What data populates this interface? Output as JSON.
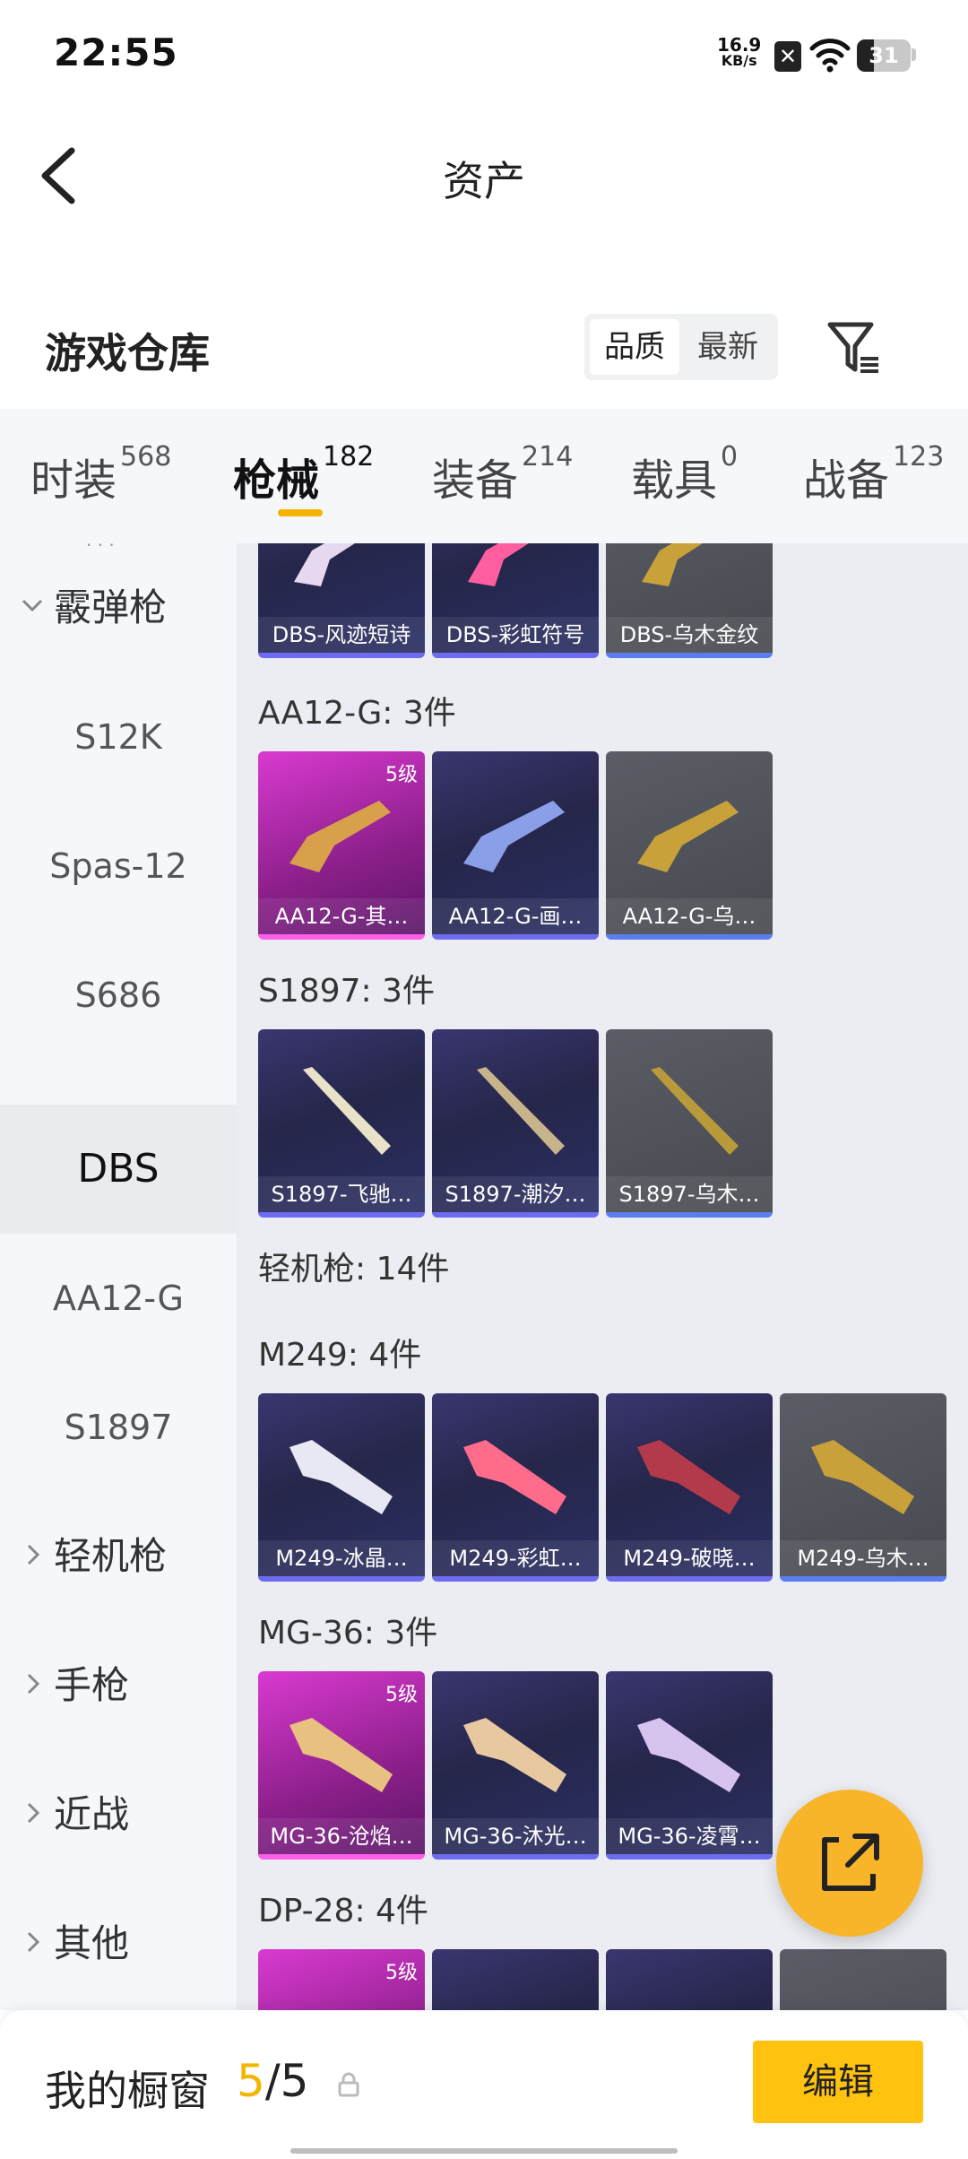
{
  "status_bar": {
    "time": "22:55",
    "net_speed_value": "16.9",
    "net_speed_unit": "KB/s",
    "battery_level": "31",
    "battery_fraction": 0.31
  },
  "header": {
    "title": "资产"
  },
  "section": {
    "title": "游戏仓库",
    "sort_options": [
      "品质",
      "最新"
    ],
    "sort_selected": "品质"
  },
  "tabs": [
    {
      "label": "时装",
      "count": "568"
    },
    {
      "label": "枪械",
      "count": "182"
    },
    {
      "label": "装备",
      "count": "214"
    },
    {
      "label": "载具",
      "count": "0"
    },
    {
      "label": "战备",
      "count": "123"
    }
  ],
  "active_tab": "枪械",
  "sidebar": {
    "top_dots": "· · ·",
    "items": [
      {
        "label": "霰弹枪",
        "type": "group",
        "expanded": true
      },
      {
        "label": "S12K",
        "type": "sub"
      },
      {
        "label": "Spas-12",
        "type": "sub"
      },
      {
        "label": "S686",
        "type": "sub"
      },
      {
        "label": "DBS",
        "type": "sub",
        "active": true
      },
      {
        "label": "AA12-G",
        "type": "sub"
      },
      {
        "label": "S1897",
        "type": "sub"
      },
      {
        "label": "轻机枪",
        "type": "group",
        "expanded": false
      },
      {
        "label": "手枪",
        "type": "group",
        "expanded": false
      },
      {
        "label": "近战",
        "type": "group",
        "expanded": false
      },
      {
        "label": "其他",
        "type": "group",
        "expanded": false
      }
    ]
  },
  "content": {
    "top_row": [
      {
        "name": "DBS-风迹短诗",
        "style": "purple"
      },
      {
        "name": "DBS-彩虹符号",
        "style": "purple"
      },
      {
        "name": "DBS-乌木金纹",
        "style": "gray"
      }
    ],
    "groups": [
      {
        "label": "AA12-G: 3件",
        "items": [
          {
            "name": "AA12-G-其…",
            "style": "pink",
            "badge": "5级"
          },
          {
            "name": "AA12-G-画…",
            "style": "purple"
          },
          {
            "name": "AA12-G-乌…",
            "style": "gray"
          }
        ]
      },
      {
        "label": "S1897: 3件",
        "items": [
          {
            "name": "S1897-飞驰…",
            "style": "purple"
          },
          {
            "name": "S1897-潮汐…",
            "style": "purple"
          },
          {
            "name": "S1897-乌木…",
            "style": "gray"
          }
        ]
      }
    ],
    "category_label": "轻机枪: 14件",
    "lmg_groups": [
      {
        "label": "M249: 4件",
        "items": [
          {
            "name": "M249-冰晶…",
            "style": "purple"
          },
          {
            "name": "M249-彩虹…",
            "style": "purple"
          },
          {
            "name": "M249-破晓…",
            "style": "purple"
          },
          {
            "name": "M249-乌木…",
            "style": "gray"
          }
        ]
      },
      {
        "label": "MG-36: 3件",
        "items": [
          {
            "name": "MG-36-沧焰…",
            "style": "pink",
            "badge": "5级"
          },
          {
            "name": "MG-36-沐光…",
            "style": "purple"
          },
          {
            "name": "MG-36-凌霄…",
            "style": "purple"
          }
        ]
      },
      {
        "label": "DP-28: 4件",
        "items": [
          {
            "name": "",
            "style": "pink",
            "badge": "5级"
          },
          {
            "name": "",
            "style": "purple"
          },
          {
            "name": "",
            "style": "purple"
          },
          {
            "name": "",
            "style": "gray"
          }
        ]
      }
    ]
  },
  "bottom_bar": {
    "label": "我的橱窗",
    "count_current": "5",
    "count_separator": "/",
    "count_total": "5",
    "edit_label": "编辑"
  },
  "colors": {
    "accent": "#f5b400",
    "edit_button": "#ffc20e",
    "fab": "#f8b52a"
  }
}
